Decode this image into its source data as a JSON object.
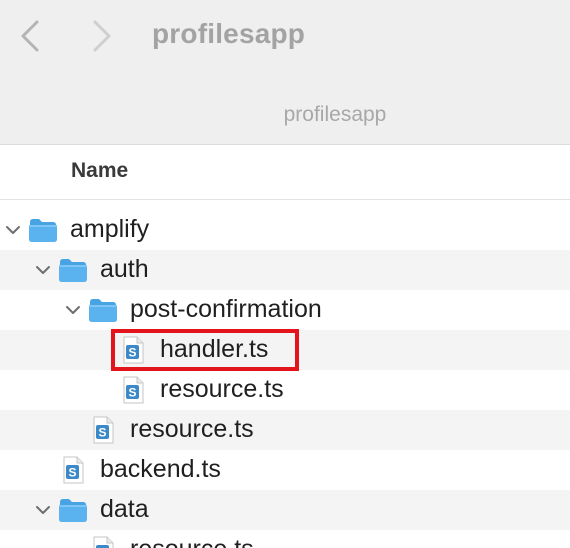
{
  "toolbar": {
    "back_icon": "chevron-left-icon",
    "forward_icon": "chevron-right-icon",
    "window_title": "profilesapp",
    "path_title": "profilesapp"
  },
  "column_header": {
    "name": "Name"
  },
  "tree": [
    {
      "label": "amplify",
      "kind": "folder",
      "expanded": true,
      "depth": 0
    },
    {
      "label": "auth",
      "kind": "folder",
      "expanded": true,
      "depth": 1
    },
    {
      "label": "post-confirmation",
      "kind": "folder",
      "expanded": true,
      "depth": 2
    },
    {
      "label": "handler.ts",
      "kind": "file",
      "depth": 3,
      "highlighted": true
    },
    {
      "label": "resource.ts",
      "kind": "file",
      "depth": 3
    },
    {
      "label": "resource.ts",
      "kind": "file",
      "depth": 2
    },
    {
      "label": "backend.ts",
      "kind": "file",
      "depth": 1
    },
    {
      "label": "data",
      "kind": "folder",
      "expanded": true,
      "depth": 1
    },
    {
      "label": "resource.ts",
      "kind": "file",
      "depth": 2
    }
  ],
  "colors": {
    "folder": "#5ab2ee",
    "folder_tab": "#48a3e2",
    "file_badge": "#3b89c9",
    "highlight": "#e3141b",
    "alt_row": "#f4f4f5"
  }
}
